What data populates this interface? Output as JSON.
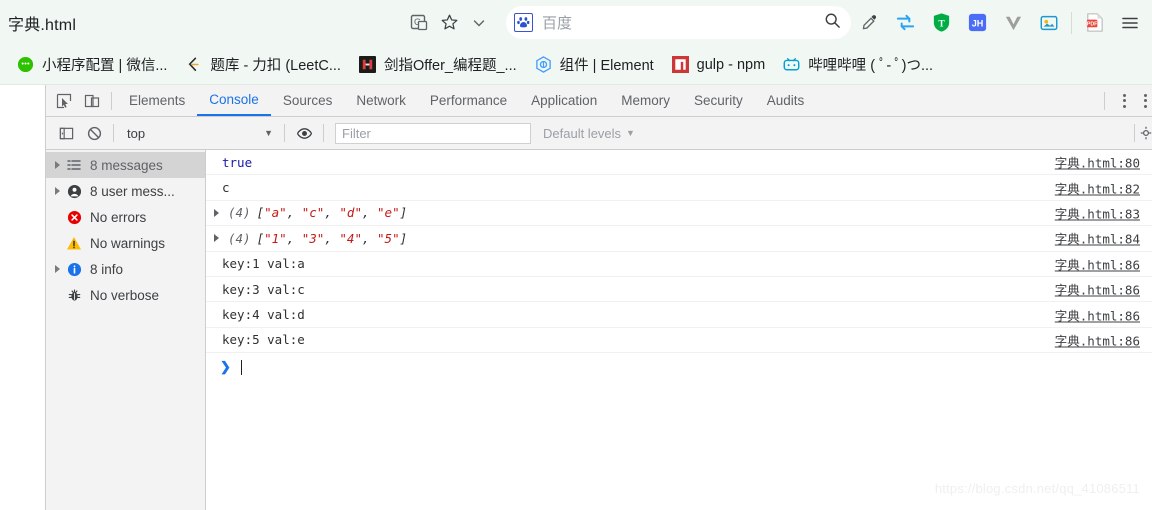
{
  "browser": {
    "tab_title": "字典.html",
    "omnibox_icons": [
      "translate-icon",
      "bookmark-star-icon",
      "chevron-down-icon"
    ],
    "search": {
      "engine_label": "百度",
      "engine_icon": "baidu-paw-icon",
      "search_icon": "search-icon"
    },
    "extensions": [
      {
        "name": "eyedropper-icon",
        "glyph": "colorpick"
      },
      {
        "name": "refresh-sync-icon",
        "glyph": "sync"
      },
      {
        "name": "tampermonkey-shield-icon",
        "glyph": "T"
      },
      {
        "name": "jh-extension-icon",
        "glyph": "JH"
      },
      {
        "name": "vue-devtools-icon",
        "glyph": "V"
      },
      {
        "name": "screenshot-extension-icon",
        "glyph": "shot"
      },
      {
        "name": "pdf-extension-icon",
        "glyph": "PDF"
      }
    ],
    "menu_icon": "hamburger-menu-icon",
    "bookmarks": [
      {
        "label": "小程序配置 | 微信...",
        "icon": "wechat-icon",
        "color": "#2dc100"
      },
      {
        "label": "题库 - 力扣 (LeetC...",
        "icon": "leetcode-icon",
        "color": "#f0a33a"
      },
      {
        "label": "剑指Offer_编程题_...",
        "icon": "nowcoder-icon",
        "color": "#1b1b1b"
      },
      {
        "label": "组件 | Element",
        "icon": "element-ui-icon",
        "color": "#409eff"
      },
      {
        "label": "gulp - npm",
        "icon": "npm-icon",
        "color": "#cb3837"
      },
      {
        "label": "哔哩哔哩 ( ﾟ- ﾟ)つ...",
        "icon": "bilibili-icon",
        "color": "#00a1d6"
      }
    ]
  },
  "devtools": {
    "inspect_icon": "inspect-element-icon",
    "device_toolbar_icon": "device-toolbar-icon",
    "tabs": [
      {
        "label": "Elements",
        "active": false
      },
      {
        "label": "Console",
        "active": true
      },
      {
        "label": "Sources",
        "active": false
      },
      {
        "label": "Network",
        "active": false
      },
      {
        "label": "Performance",
        "active": false
      },
      {
        "label": "Application",
        "active": false
      },
      {
        "label": "Memory",
        "active": false
      },
      {
        "label": "Security",
        "active": false
      },
      {
        "label": "Audits",
        "active": false
      }
    ],
    "more_tools_icon": "kebab-menu-icon",
    "close_icon": "close-devtools-icon",
    "toolbar": {
      "sidebar_toggle_icon": "console-sidebar-toggle-icon",
      "clear_console_icon": "clear-console-icon",
      "context_value": "top",
      "context_caret": "▼",
      "eye_icon": "live-expression-eye-icon",
      "filter_placeholder": "Filter",
      "levels_label": "Default levels",
      "levels_caret": "▼",
      "settings_icon": "console-settings-icon"
    },
    "sidebar": [
      {
        "label": "8 messages",
        "icon": "list-icon",
        "expandable": true,
        "selected": true
      },
      {
        "label": "8 user mess...",
        "icon": "user-icon",
        "expandable": true,
        "selected": false
      },
      {
        "label": "No errors",
        "icon": "error-icon",
        "expandable": false,
        "selected": false
      },
      {
        "label": "No warnings",
        "icon": "warning-icon",
        "expandable": false,
        "selected": false
      },
      {
        "label": "8 info",
        "icon": "info-icon",
        "expandable": true,
        "selected": false
      },
      {
        "label": "No verbose",
        "icon": "bug-icon",
        "expandable": false,
        "selected": false
      }
    ],
    "messages": [
      {
        "kind": "bool",
        "text": "true",
        "source": "字典.html:80"
      },
      {
        "kind": "text",
        "text": "c",
        "source": "字典.html:82"
      },
      {
        "kind": "array",
        "count": "(4)",
        "items": [
          "a",
          "c",
          "d",
          "e"
        ],
        "source": "字典.html:83"
      },
      {
        "kind": "array",
        "count": "(4)",
        "items": [
          "1",
          "3",
          "4",
          "5"
        ],
        "source": "字典.html:84"
      },
      {
        "kind": "text",
        "text": "key:1 val:a",
        "source": "字典.html:86"
      },
      {
        "kind": "text",
        "text": "key:3 val:c",
        "source": "字典.html:86"
      },
      {
        "kind": "text",
        "text": "key:4 val:d",
        "source": "字典.html:86"
      },
      {
        "kind": "text",
        "text": "key:5 val:e",
        "source": "字典.html:86"
      }
    ],
    "prompt_chevron": "❯",
    "prompt_value": ""
  },
  "watermark": "https://blog.csdn.net/qq_41086511"
}
